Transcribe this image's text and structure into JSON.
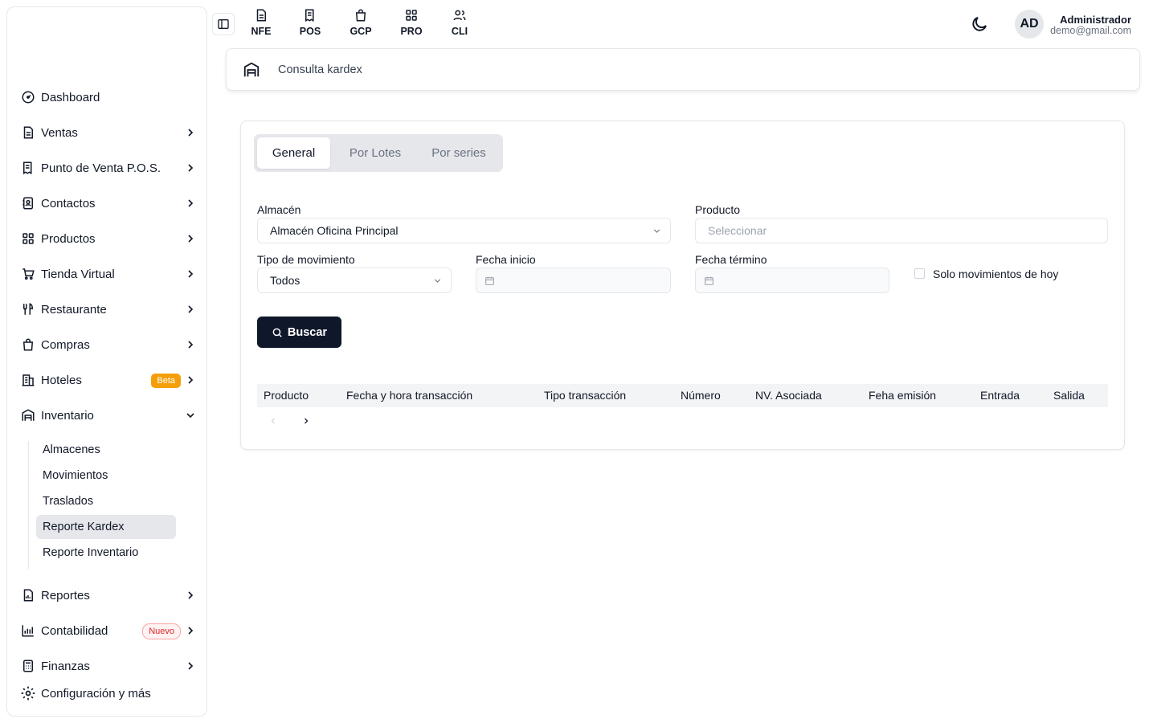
{
  "sidebar": {
    "items": [
      {
        "label": "Dashboard",
        "icon": "gauge-icon"
      },
      {
        "label": "Ventas",
        "icon": "document-icon"
      },
      {
        "label": "Punto de Venta P.O.S.",
        "icon": "receipt-icon"
      },
      {
        "label": "Contactos",
        "icon": "contacts-icon"
      },
      {
        "label": "Productos",
        "icon": "grid-icon"
      },
      {
        "label": "Tienda Virtual",
        "icon": "cart-icon"
      },
      {
        "label": "Restaurante",
        "icon": "utensils-icon"
      },
      {
        "label": "Compras",
        "icon": "bag-icon"
      },
      {
        "label": "Hoteles",
        "icon": "hotel-icon",
        "badge": "Beta"
      },
      {
        "label": "Inventario",
        "icon": "warehouse-icon"
      },
      {
        "label": "Reportes",
        "icon": "report-icon"
      },
      {
        "label": "Contabilidad",
        "icon": "chart-icon",
        "badge": "Nuevo"
      },
      {
        "label": "Finanzas",
        "icon": "calculator-icon"
      },
      {
        "label": "Configuración y más",
        "icon": "gear-icon"
      }
    ],
    "inventario_sub": [
      "Almacenes",
      "Movimientos",
      "Traslados",
      "Reporte Kardex",
      "Reporte Inventario"
    ]
  },
  "topnav": [
    "NFE",
    "POS",
    "GCP",
    "PRO",
    "CLI"
  ],
  "user": {
    "initials": "AD",
    "name": "Administrador",
    "email": "demo@gmail.com"
  },
  "breadcrumb": "Consulta kardex",
  "tabs": [
    "General",
    "Por Lotes",
    "Por series"
  ],
  "form": {
    "almacen_label": "Almacén",
    "almacen_value": "Almacén Oficina Principal",
    "producto_label": "Producto",
    "producto_placeholder": "Seleccionar",
    "tipo_label": "Tipo de movimiento",
    "tipo_value": "Todos",
    "fecha_inicio_label": "Fecha inicio",
    "fecha_termino_label": "Fecha término",
    "solo_hoy_label": "Solo movimientos de hoy",
    "buscar_label": "Buscar"
  },
  "table": {
    "headers": [
      "Producto",
      "Fecha y hora transacción",
      "Tipo transacción",
      "Número",
      "NV. Asociada",
      "Feha emisión",
      "Entrada",
      "Salida"
    ]
  },
  "colors": {
    "primary_button": "#0f172a",
    "beta_badge": "#f59e0b",
    "new_badge": "#dc2626"
  }
}
